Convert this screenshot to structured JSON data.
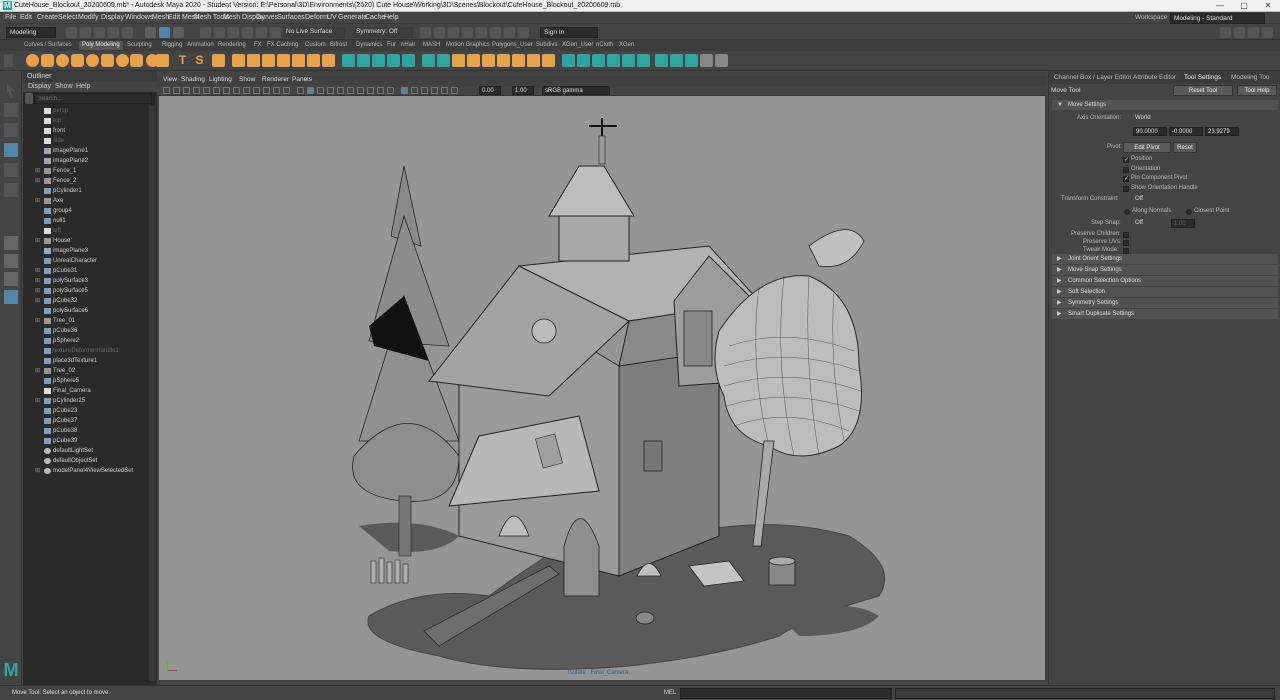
{
  "window": {
    "title": "CuteHouse_Blockout_20200609.mb* - Autodesk Maya 2020 - Student Version: E:\\Personal\\3D\\Environments\\(2020) Cute House\\Working\\3D\\Scenes\\Blockout\\CuteHouse_Blockout_20200609.mb",
    "minimize": "—",
    "maximize": "▢",
    "close": "✕"
  },
  "menubar": [
    "File",
    "Edit",
    "Create",
    "Select",
    "Modify",
    "Display",
    "Windows",
    "Mesh",
    "Edit Mesh",
    "Mesh Tools",
    "Mesh Display",
    "Curves",
    "Surfaces",
    "Deform",
    "UV",
    "Generate",
    "Cache",
    "Help"
  ],
  "workspace": {
    "label": "Workspace :",
    "value": "Modeling - Standard"
  },
  "statusline": {
    "menuset": "Modeling",
    "live_surface": "No Live Surface",
    "symmetry": "Symmetry: Off",
    "sign_in": "Sign In"
  },
  "shelf_tabs": [
    "Curves / Surfaces",
    "Poly Modeling",
    "Sculpting",
    "Rigging",
    "Animation",
    "Rendering",
    "FX",
    "FX Caching",
    "Custom",
    "Bifrost",
    "Dynamics",
    "Fur",
    "nHair",
    "MASH",
    "Motion Graphics",
    "Polygons_User",
    "Subdivs",
    "XGen_User",
    "nCloth",
    "XGen"
  ],
  "shelf_active": "Poly Modeling",
  "outliner": {
    "title": "Outliner",
    "menus": [
      "Display",
      "Show",
      "Help"
    ],
    "search_placeholder": "Search...",
    "items": [
      {
        "label": "persp",
        "dim": true,
        "exp": false,
        "icon": "camera-icon"
      },
      {
        "label": "top",
        "dim": true,
        "exp": false,
        "icon": "camera-icon"
      },
      {
        "label": "front",
        "dim": false,
        "exp": false,
        "icon": "camera-icon"
      },
      {
        "label": "side",
        "dim": true,
        "exp": false,
        "icon": "camera-icon"
      },
      {
        "label": "imagePlane1",
        "dim": false,
        "exp": false,
        "icon": "image-plane-icon"
      },
      {
        "label": "imagePlane2",
        "dim": false,
        "exp": false,
        "icon": "image-plane-icon"
      },
      {
        "label": "Fence_1",
        "dim": false,
        "exp": true,
        "icon": "group-icon"
      },
      {
        "label": "Fence_2",
        "dim": false,
        "exp": true,
        "icon": "group-icon"
      },
      {
        "label": "pCylinder1",
        "dim": false,
        "exp": false,
        "icon": "mesh-icon"
      },
      {
        "label": "Axe",
        "dim": false,
        "exp": true,
        "icon": "group-icon"
      },
      {
        "label": "group4",
        "dim": false,
        "exp": false,
        "icon": "mesh-icon"
      },
      {
        "label": "null1",
        "dim": false,
        "exp": false,
        "icon": "mesh-icon"
      },
      {
        "label": "left",
        "dim": true,
        "exp": false,
        "icon": "camera-icon"
      },
      {
        "label": "House",
        "dim": false,
        "exp": true,
        "icon": "group-icon"
      },
      {
        "label": "imagePlane3",
        "dim": false,
        "exp": false,
        "icon": "image-plane-icon"
      },
      {
        "label": "UnrealCharacter",
        "dim": false,
        "exp": false,
        "icon": "mesh-icon"
      },
      {
        "label": "pCube31",
        "dim": false,
        "exp": true,
        "icon": "mesh-icon"
      },
      {
        "label": "polySurface3",
        "dim": false,
        "exp": true,
        "icon": "mesh-icon"
      },
      {
        "label": "polySurface5",
        "dim": false,
        "exp": true,
        "icon": "mesh-icon"
      },
      {
        "label": "pCube32",
        "dim": false,
        "exp": true,
        "icon": "mesh-icon"
      },
      {
        "label": "polySurface6",
        "dim": false,
        "exp": false,
        "icon": "mesh-icon"
      },
      {
        "label": "Tree_01",
        "dim": false,
        "exp": true,
        "icon": "group-icon"
      },
      {
        "label": "pCube36",
        "dim": false,
        "exp": false,
        "icon": "mesh-icon"
      },
      {
        "label": "pSphere2",
        "dim": false,
        "exp": false,
        "icon": "mesh-icon"
      },
      {
        "label": "textureDeformerHandle1",
        "dim": true,
        "exp": false,
        "icon": "mesh-icon"
      },
      {
        "label": "place3dTexture1",
        "dim": false,
        "exp": false,
        "icon": "mesh-icon"
      },
      {
        "label": "Tree_02",
        "dim": false,
        "exp": true,
        "icon": "group-icon"
      },
      {
        "label": "pSphere5",
        "dim": false,
        "exp": false,
        "icon": "mesh-icon"
      },
      {
        "label": "Final_Camera",
        "dim": false,
        "exp": false,
        "icon": "camera-icon"
      },
      {
        "label": "pCylinder25",
        "dim": false,
        "exp": true,
        "icon": "mesh-icon"
      },
      {
        "label": "pCube23",
        "dim": false,
        "exp": false,
        "icon": "mesh-icon"
      },
      {
        "label": "pCube37",
        "dim": false,
        "exp": false,
        "icon": "mesh-icon"
      },
      {
        "label": "pCube38",
        "dim": false,
        "exp": false,
        "icon": "mesh-icon"
      },
      {
        "label": "pCube39",
        "dim": false,
        "exp": false,
        "icon": "mesh-icon"
      },
      {
        "label": "defaultLightSet",
        "dim": false,
        "exp": false,
        "icon": "set-icon"
      },
      {
        "label": "defaultObjectSet",
        "dim": false,
        "exp": false,
        "icon": "set-icon"
      },
      {
        "label": "modelPanel4ViewSelectedSet",
        "dim": false,
        "exp": true,
        "icon": "set-icon"
      }
    ]
  },
  "viewport": {
    "menus": [
      "View",
      "Shading",
      "Lighting",
      "Show",
      "Renderer",
      "Panels"
    ],
    "exposure": "0.00",
    "gamma": "1.00",
    "color_space": "sRGB gamma",
    "camera_label": "Isolate : Final_Camera"
  },
  "right_panel": {
    "tabs": [
      "Channel Box / Layer Editor",
      "Attribute Editor",
      "Tool Settings",
      "Modeling Too"
    ],
    "active_tab": "Tool Settings",
    "tool_name": "Move Tool",
    "reset_button": "Reset Tool",
    "help_button": "Tool Help",
    "move_settings": "Move Settings",
    "axis_orientation_label": "Axis Orientation:",
    "axis_orientation_value": "World",
    "axis_values": [
      "90.0000",
      "-0.0000",
      "23.9279"
    ],
    "pivot_label": "Pivot:",
    "edit_pivot": "Edit Pivot",
    "reset_pivot": "Reset",
    "pivot_options": [
      {
        "label": "Position",
        "checked": true
      },
      {
        "label": "Orientation",
        "checked": false
      },
      {
        "label": "Pin Component Pivot",
        "checked": true
      },
      {
        "label": "Show Orientation Handle",
        "checked": false
      }
    ],
    "transform_constraint_label": "Transform Constraint:",
    "transform_constraint_value": "Off",
    "along_normals": "Along Normals",
    "closest_point": "Closest Point",
    "step_snap_label": "Step Snap:",
    "step_snap_value": "Off",
    "step_snap_amount": "1.00",
    "preserve_children": "Preserve Children:",
    "preserve_uvs": "Preserve UVs:",
    "tweak_mode": "Tweak Mode:",
    "sections": [
      "Joint Orient Settings",
      "Move Snap Settings",
      "Common Selection Options",
      "Soft Selection",
      "Symmetry Settings",
      "Smart Duplicate Settings"
    ]
  },
  "helpline": {
    "text": "Move Tool: Select an object to move.",
    "mel": "MEL"
  },
  "colors": {
    "ui_bg": "#444444",
    "panel_dark": "#2a2a2a",
    "accent_blue": "#5285a6",
    "shelf_orange": "#e8a24a",
    "shelf_teal": "#2fa7a0",
    "viewport_bg": "#959595"
  }
}
